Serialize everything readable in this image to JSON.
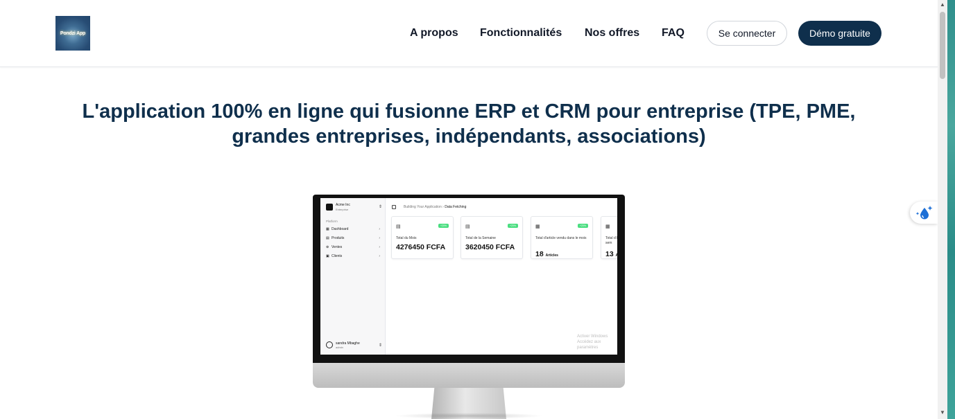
{
  "header": {
    "logo_text": "Pondzi App",
    "nav": [
      "A propos",
      "Fonctionnalités",
      "Nos offres",
      "FAQ"
    ],
    "login_label": "Se connecter",
    "demo_label": "Démo gratuite"
  },
  "hero": {
    "title": "L'application 100% en ligne qui fusionne ERP et CRM pour entreprise (TPE, PME, grandes entreprises, indépendants, associations)"
  },
  "mockup": {
    "org_name": "Acme Inc",
    "org_sub": "Enterprise",
    "section_label": "Platform",
    "sidebar_items": [
      "Dashboard",
      "Produits",
      "Ventes",
      "Clients"
    ],
    "breadcrumb_root": "Building Your Application",
    "breadcrumb_current": "Data Fetching",
    "cards": [
      {
        "badge": "+20%",
        "label": "Total du Mois",
        "value": "4276450 FCFA"
      },
      {
        "badge": "+20%",
        "label": "Total de la Semaine",
        "value": "3620450 FCFA"
      },
      {
        "badge": "+20%",
        "label": "Total d'article vendu dans le mois",
        "value": "18",
        "unit": "Articles"
      },
      {
        "badge": "",
        "label": "Total d la sem",
        "value": "13",
        "unit": "Ar"
      }
    ],
    "user_name": "sandra Mbaghe",
    "user_role": "admin",
    "watermark_line1": "Activer Windows",
    "watermark_line2": "Accédez aux paramètres"
  },
  "colors": {
    "brand_dark": "#0f2f4c",
    "badge_green": "#4ade80"
  }
}
